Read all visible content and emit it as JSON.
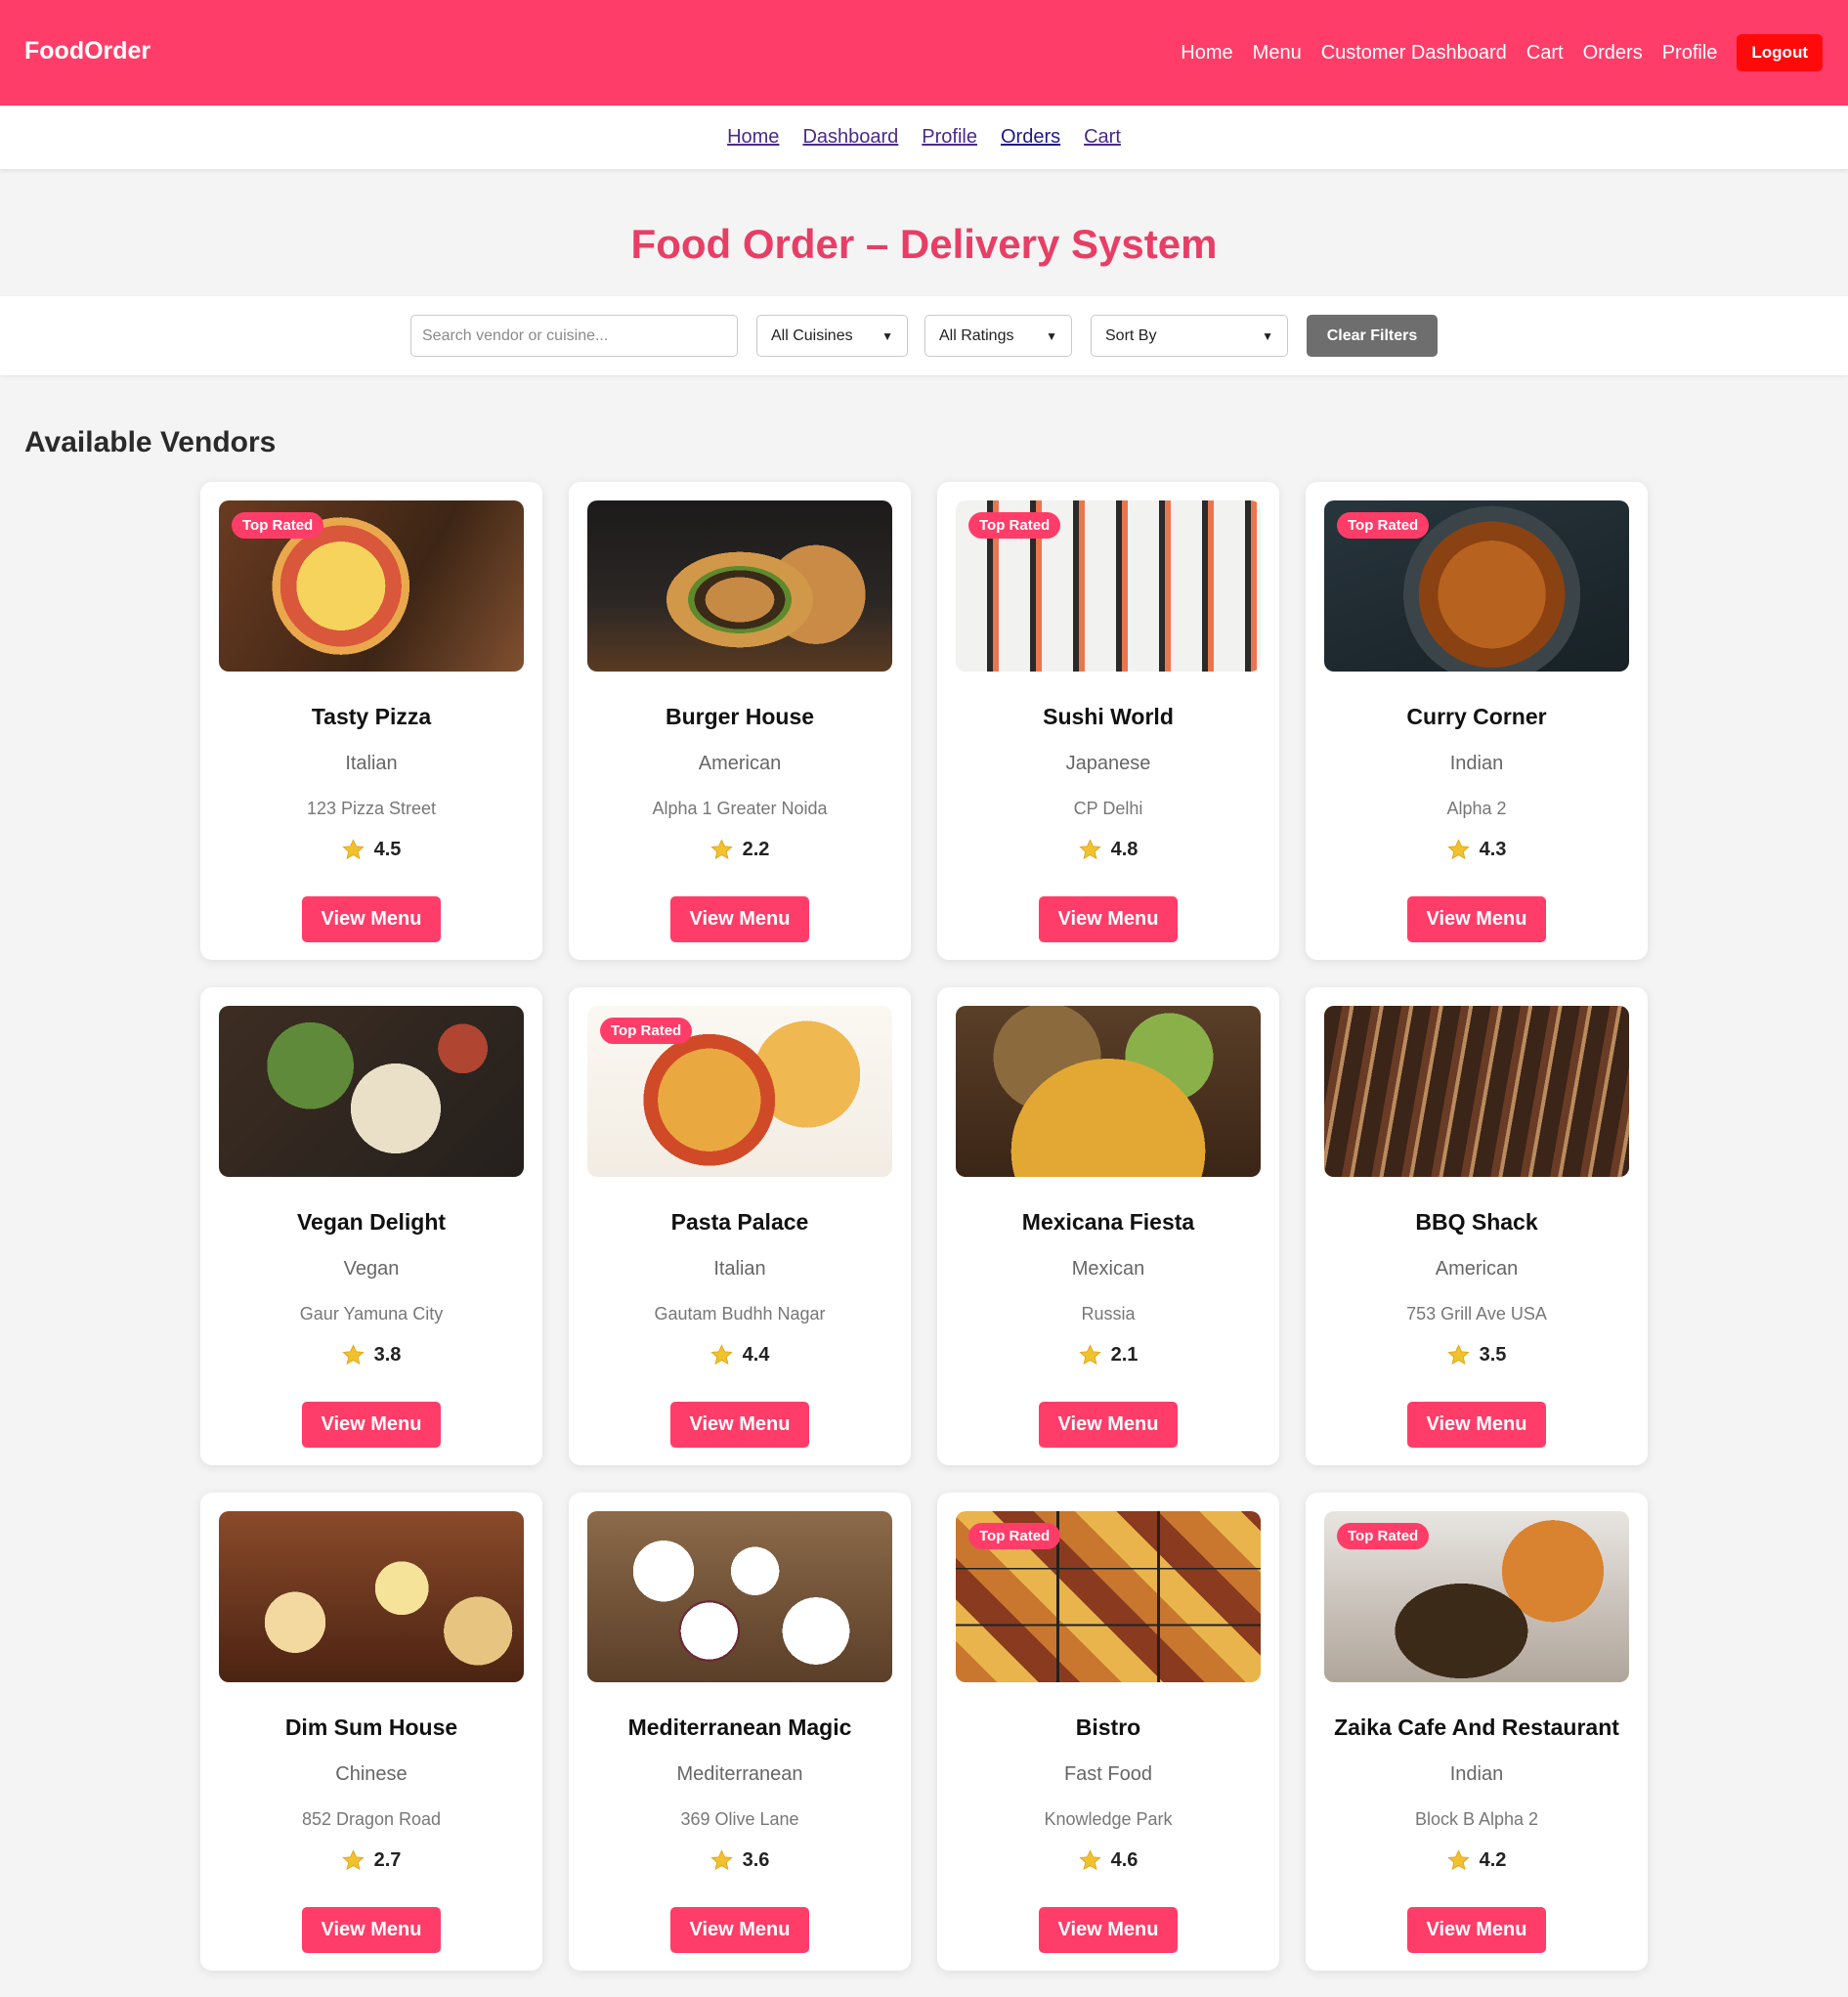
{
  "navbar": {
    "brand": "FoodOrder",
    "links": [
      "Home",
      "Menu",
      "Customer Dashboard",
      "Cart",
      "Orders",
      "Profile"
    ],
    "logout_label": "Logout",
    "accent": "#ff3d68"
  },
  "subnav": {
    "links": [
      "Home",
      "Dashboard",
      "Profile",
      "Orders",
      "Cart"
    ]
  },
  "page_title": "Food Order – Delivery System",
  "filters": {
    "search_placeholder": "Search vendor or cuisine...",
    "cuisine_selected": "All Cuisines",
    "rating_selected": "All Ratings",
    "sort_selected": "Sort By",
    "clear_label": "Clear Filters"
  },
  "section_title": "Available Vendors",
  "vendor_button_label": "View Menu",
  "vendors": [
    {
      "name": "Tasty Pizza",
      "cuisine": "Italian",
      "address": "123 Pizza Street",
      "rating": "4.5",
      "badge": "Top Rated",
      "image": "pizza"
    },
    {
      "name": "Burger House",
      "cuisine": "American",
      "address": "Alpha 1 Greater Noida",
      "rating": "2.2",
      "badge": "",
      "image": "burger"
    },
    {
      "name": "Sushi World",
      "cuisine": "Japanese",
      "address": "CP Delhi",
      "rating": "4.8",
      "badge": "Top Rated",
      "image": "sushi"
    },
    {
      "name": "Curry Corner",
      "cuisine": "Indian",
      "address": "Alpha 2",
      "rating": "4.3",
      "badge": "Top Rated",
      "image": "curry"
    },
    {
      "name": "Vegan Delight",
      "cuisine": "Vegan",
      "address": "Gaur Yamuna City",
      "rating": "3.8",
      "badge": "",
      "image": "vegan"
    },
    {
      "name": "Pasta Palace",
      "cuisine": "Italian",
      "address": "Gautam Budhh Nagar",
      "rating": "4.4",
      "badge": "Top Rated",
      "image": "pasta"
    },
    {
      "name": "Mexicana Fiesta",
      "cuisine": "Mexican",
      "address": "Russia",
      "rating": "2.1",
      "badge": "",
      "image": "mex"
    },
    {
      "name": "BBQ Shack",
      "cuisine": "American",
      "address": "753 Grill Ave USA",
      "rating": "3.5",
      "badge": "",
      "image": "bbq"
    },
    {
      "name": "Dim Sum House",
      "cuisine": "Chinese",
      "address": "852 Dragon Road",
      "rating": "2.7",
      "badge": "",
      "image": "dimsum"
    },
    {
      "name": "Mediterranean Magic",
      "cuisine": "Mediterranean",
      "address": "369 Olive Lane",
      "rating": "3.6",
      "badge": "",
      "image": "med"
    },
    {
      "name": "Bistro",
      "cuisine": "Fast Food",
      "address": "Knowledge Park",
      "rating": "4.6",
      "badge": "Top Rated",
      "image": "bistro"
    },
    {
      "name": "Zaika Cafe And Restaurant",
      "cuisine": "Indian",
      "address": "Block B Alpha 2",
      "rating": "4.2",
      "badge": "Top Rated",
      "image": "zaika"
    }
  ]
}
